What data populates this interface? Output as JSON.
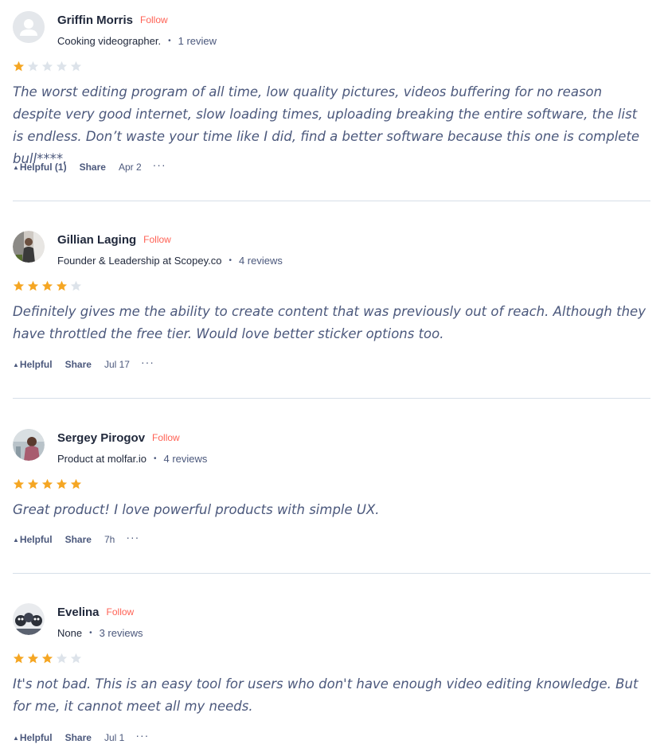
{
  "colors": {
    "star_filled": "#f5a623",
    "star_empty": "#dde3ea",
    "follow": "#ff6154",
    "divider": "#d6dfe8"
  },
  "reviews": [
    {
      "name": "Griffin Morris",
      "follow_label": "Follow",
      "headline": "Cooking videographer.",
      "review_count": "1 review",
      "rating": 1,
      "text": "The worst editing program of all time, low quality pictures, videos buffering for no reason despite very good internet, slow loading times, uploading breaking the entire software, the list is endless. Don’t waste your time like I did, find a better software because this one is complete bull****.",
      "helpful_label": "Helpful (1)",
      "share_label": "Share",
      "date": "Apr 2",
      "more_label": "···",
      "avatar": "default-avatar-icon"
    },
    {
      "name": "Gillian Laging",
      "follow_label": "Follow",
      "headline": "Founder & Leadership at Scopey.co",
      "review_count": "4 reviews",
      "rating": 4,
      "text": "Definitely gives me the ability to create content that was previously out of reach. Although they have throttled the free tier. Would love better sticker options too.",
      "helpful_label": "Helpful",
      "share_label": "Share",
      "date": "Jul 17",
      "more_label": "···",
      "avatar": "user-photo"
    },
    {
      "name": "Sergey Pirogov",
      "follow_label": "Follow",
      "headline": "Product at molfar.io",
      "review_count": "4 reviews",
      "rating": 5,
      "text": "Great product! I love powerful products with simple UX.",
      "helpful_label": "Helpful",
      "share_label": "Share",
      "date": "7h",
      "more_label": "···",
      "avatar": "user-photo"
    },
    {
      "name": "Evelina",
      "follow_label": "Follow",
      "headline": "None",
      "review_count": "3 reviews",
      "rating": 3,
      "text": "It's not bad. This is an easy tool for users who don't have enough video editing knowledge. But for me, it cannot meet all my needs.",
      "helpful_label": "Helpful",
      "share_label": "Share",
      "date": "Jul 1",
      "more_label": "···",
      "avatar": "user-photo"
    }
  ]
}
